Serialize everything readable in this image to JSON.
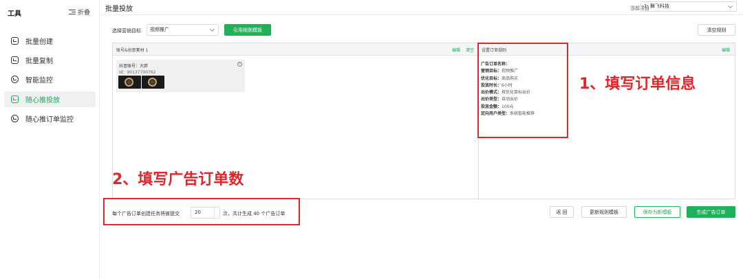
{
  "sidebar": {
    "title": "工具",
    "fold_label": "折叠",
    "items": [
      {
        "label": "批量创建",
        "active": false
      },
      {
        "label": "批量复制",
        "active": false
      },
      {
        "label": "智能监控",
        "active": false
      },
      {
        "label": "随心推投放",
        "active": true
      },
      {
        "label": "随心推订单监控",
        "active": false
      }
    ]
  },
  "header": {
    "title": "批量投放",
    "project_label": "当前项目",
    "project_value": "1: 舞飞科技"
  },
  "toolbar": {
    "goal_label": "选择营销目标",
    "goal_value": "视频推广",
    "use_template_label": "引用规则模板",
    "clear_rules_label": "清空规则"
  },
  "left_panel": {
    "header": "账号&创意素材 1",
    "edit_label": "编辑",
    "clear_label": "清空",
    "card": {
      "account": "抖音账号：大胖",
      "id": "id：90137700762"
    }
  },
  "right_panel": {
    "header": "设置订单规则",
    "edit_label": "编辑",
    "rules": [
      {
        "key": "广告订单名称：",
        "value": ""
      },
      {
        "key": "营销目标：",
        "value": "视频推广"
      },
      {
        "key": "优化目标：",
        "value": "商品购买"
      },
      {
        "key": "投放时长：",
        "value": "6小时"
      },
      {
        "key": "出价模式：",
        "value": "按优化目标出价"
      },
      {
        "key": "出价类型：",
        "value": "自动出价"
      },
      {
        "key": "投放金额：",
        "value": "100元"
      },
      {
        "key": "定向用户类型：",
        "value": "系统智能推荐"
      }
    ]
  },
  "annotations": {
    "step1": "1、填写订单信息",
    "step2": "2、填写广告订单数"
  },
  "footer": {
    "prefix": "每个广告订单创建任务将被提交",
    "count": "20",
    "suffix": "次，共计生成 40 个广告订单",
    "back_label": "返 回",
    "update_template_label": "更新规则模板",
    "save_template_label": "保存为新模板",
    "generate_label": "生成广告订单"
  },
  "colors": {
    "accent": "#1fb05a",
    "annotation": "#e0262b"
  }
}
